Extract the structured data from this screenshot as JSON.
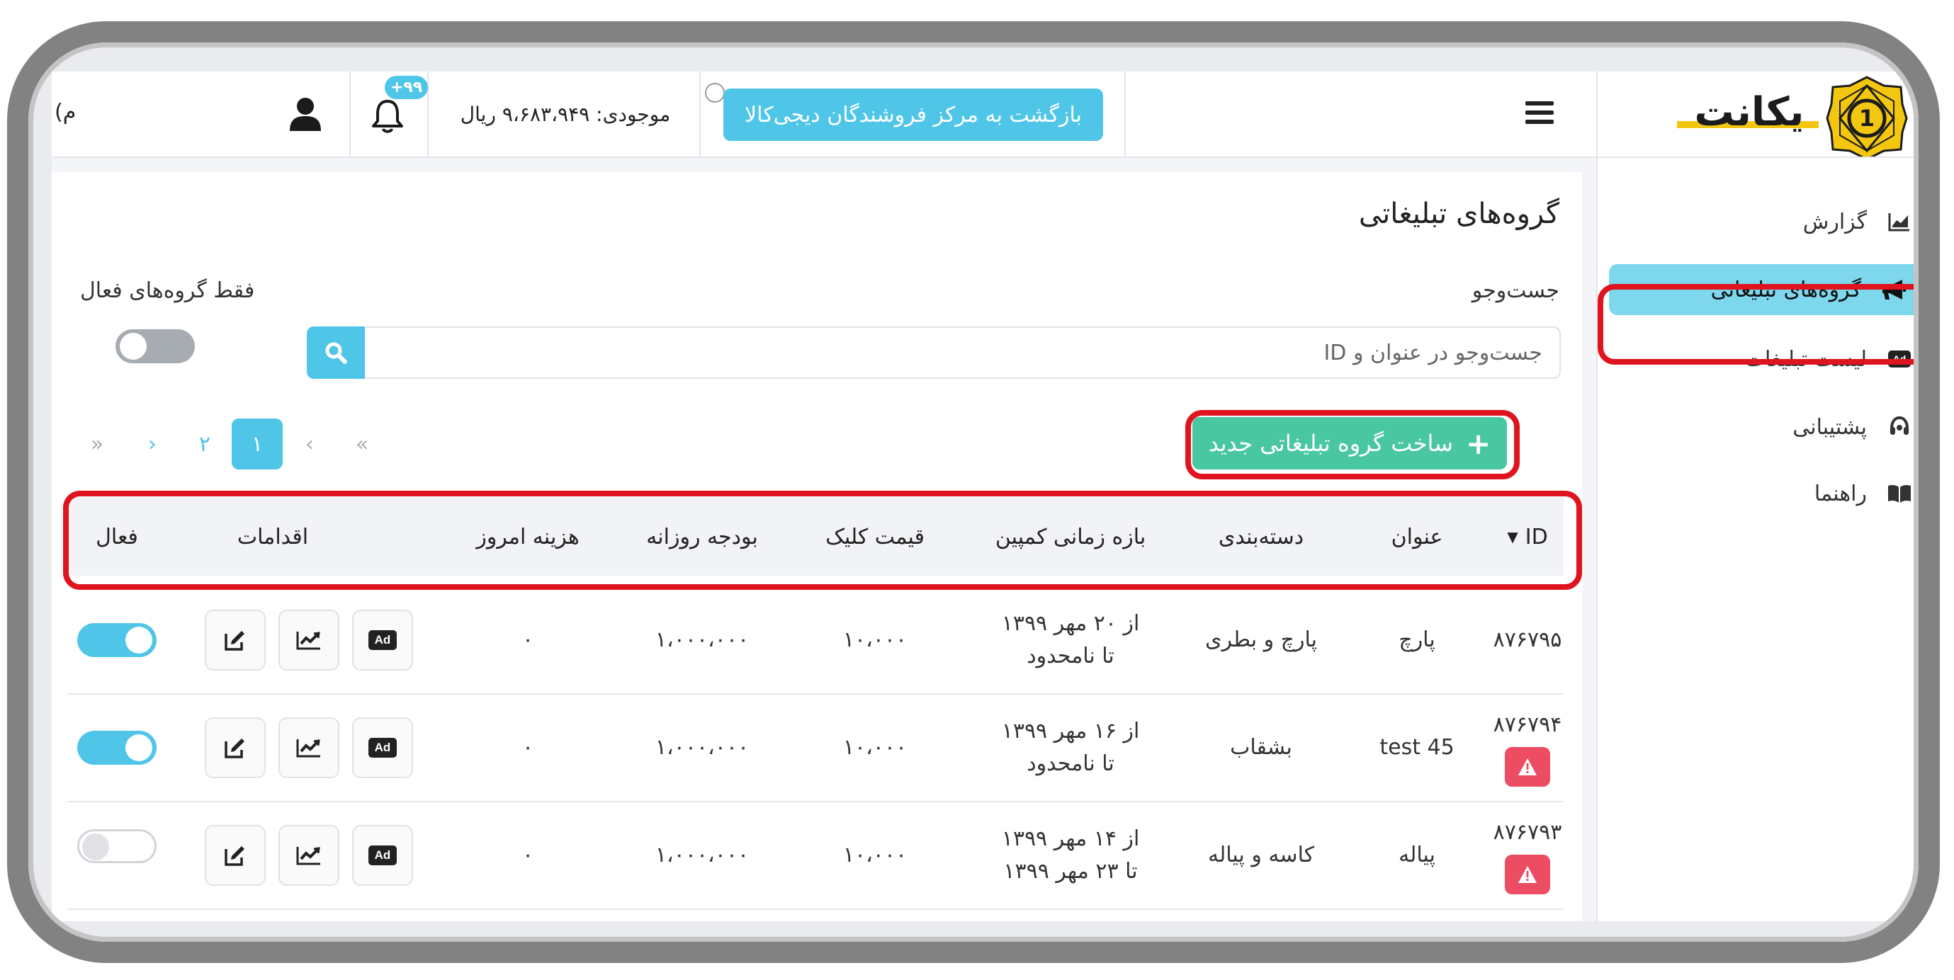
{
  "header": {
    "cut_text": "(م",
    "notification_badge": "+۹۹",
    "balance": "موجودی: ۹،۶۸۳،۹۴۹ ریال",
    "back_button": "بازگشت به مرکز فروشندگان دیجی‌کالا"
  },
  "logo": {
    "number": "1",
    "text": "یکانت"
  },
  "sidebar": {
    "items": [
      {
        "label": "گزارش",
        "icon": "chart-area-icon"
      },
      {
        "label": "گروه‌های تبلیغاتی",
        "icon": "megaphone-icon"
      },
      {
        "label": "لیست تبلیغات",
        "icon": "ad-icon"
      },
      {
        "label": "پشتیبانی",
        "icon": "headset-icon"
      },
      {
        "label": "راهنما",
        "icon": "book-icon"
      }
    ]
  },
  "page": {
    "title": "گروه‌های تبلیغاتی",
    "search_label": "جست‌وجو",
    "search_placeholder": "جست‌وجو در عنوان و ID",
    "only_active_label": "فقط گروه‌های فعال",
    "new_group_button": "ساخت گروه تبلیغاتی جدید"
  },
  "pagination": {
    "first": "«",
    "prev": "‹",
    "current": "۱",
    "next_page": "۲",
    "next": "›",
    "last": "»"
  },
  "table": {
    "headers": {
      "id": "ID",
      "title": "عنوان",
      "category": "دسته‌بندی",
      "period": "بازه زمانی کمپین",
      "click_price": "قیمت کلیک",
      "daily_budget": "بودجه روزانه",
      "today_cost": "هزینه امروز",
      "actions": "اقدامات",
      "active": "فعال"
    },
    "rows": [
      {
        "id": "۸۷۶۷۹۵",
        "title": "پارچ",
        "category": "پارچ و بطری",
        "period_from": "از ۲۰ مهر ۱۳۹۹",
        "period_to": "تا نامحدود",
        "click_price": "۱۰،۰۰۰",
        "daily_budget": "۱،۰۰۰،۰۰۰",
        "today_cost": "۰",
        "active": true,
        "warning": false
      },
      {
        "id": "۸۷۶۷۹۴",
        "title": "test 45",
        "category": "بشقاب",
        "period_from": "از ۱۶ مهر ۱۳۹۹",
        "period_to": "تا نامحدود",
        "click_price": "۱۰،۰۰۰",
        "daily_budget": "۱،۰۰۰،۰۰۰",
        "today_cost": "۰",
        "active": true,
        "warning": true
      },
      {
        "id": "۸۷۶۷۹۳",
        "title": "پیاله",
        "category": "کاسه و پیاله",
        "period_from": "از ۱۴ مهر ۱۳۹۹",
        "period_to": "تا ۲۳ مهر ۱۳۹۹",
        "click_price": "۱۰،۰۰۰",
        "daily_budget": "۱،۰۰۰،۰۰۰",
        "today_cost": "۰",
        "active": false,
        "warning": true
      }
    ]
  },
  "colors": {
    "accent": "#4fc6e8",
    "success": "#49c7a0",
    "danger": "#ec4d63",
    "highlight": "#e0141e",
    "sidebar_active": "#7dd8ee"
  }
}
